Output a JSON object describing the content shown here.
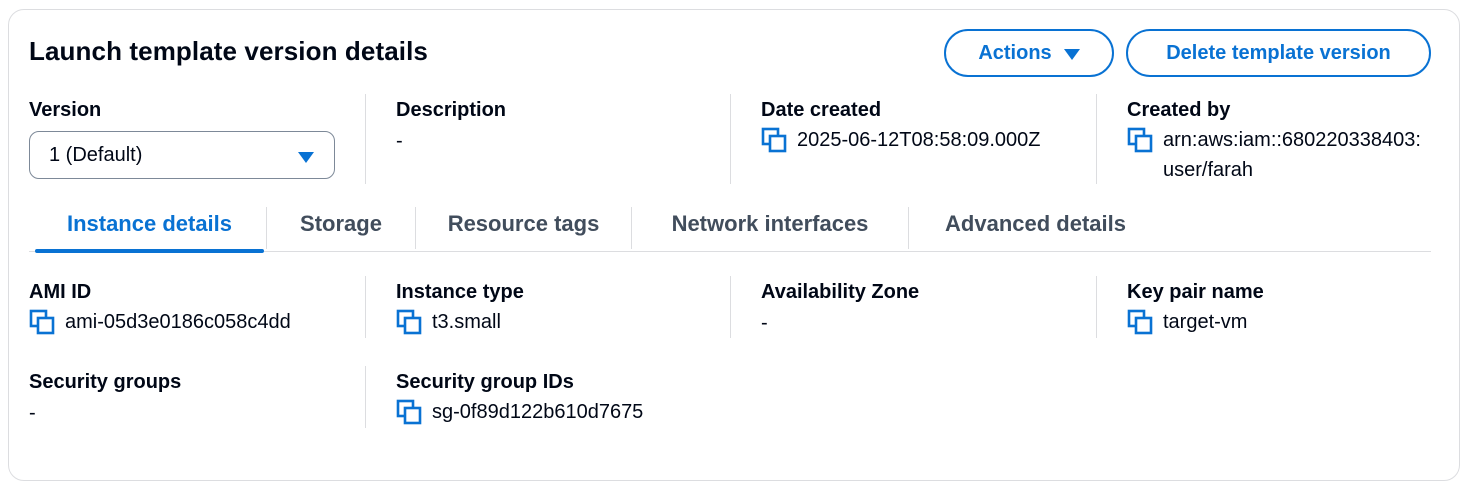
{
  "header": {
    "title": "Launch template version details",
    "actions_label": "Actions",
    "delete_label": "Delete template version"
  },
  "summary": {
    "version": {
      "label": "Version",
      "selected": "1 (Default)"
    },
    "description": {
      "label": "Description",
      "value": "-"
    },
    "date_created": {
      "label": "Date created",
      "value": "2025-06-12T08:58:09.000Z"
    },
    "created_by": {
      "label": "Created by",
      "value": "arn:aws:iam::680220338403:user/farah"
    }
  },
  "tabs": [
    {
      "label": "Instance details",
      "active": true
    },
    {
      "label": "Storage",
      "active": false
    },
    {
      "label": "Resource tags",
      "active": false
    },
    {
      "label": "Network interfaces",
      "active": false
    },
    {
      "label": "Advanced details",
      "active": false
    }
  ],
  "instance_details": {
    "ami_id": {
      "label": "AMI ID",
      "value": "ami-05d3e0186c058c4dd"
    },
    "instance_type": {
      "label": "Instance type",
      "value": "t3.small"
    },
    "availability_zone": {
      "label": "Availability Zone",
      "value": "-"
    },
    "key_pair_name": {
      "label": "Key pair name",
      "value": "target-vm"
    },
    "security_groups": {
      "label": "Security groups",
      "value": "-"
    },
    "security_group_ids": {
      "label": "Security group IDs",
      "value": "sg-0f89d122b610d7675"
    }
  },
  "colors": {
    "accent": "#0972d3",
    "text": "#000716",
    "muted_text": "#414d5c",
    "border": "#dcdde0"
  },
  "icons": {
    "copy": "copy-icon",
    "dropdown": "caret-down-icon"
  }
}
